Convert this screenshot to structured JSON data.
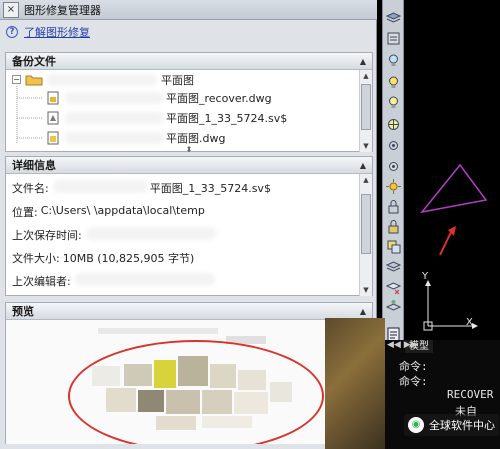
{
  "panel": {
    "title": "图形修复管理器",
    "close_label": "×",
    "learn_link": "了解图形修复"
  },
  "backup": {
    "header": "备份文件",
    "folder_label": "平面图",
    "files": [
      {
        "name": "平面图_recover.dwg"
      },
      {
        "name": "平面图_1_33_5724.sv$"
      },
      {
        "name": "平面图.dwg"
      }
    ]
  },
  "details": {
    "header": "详细信息",
    "rows": [
      {
        "label": "文件名:",
        "value": "平面图_1_33_5724.sv$"
      },
      {
        "label": "位置:",
        "value": "C:\\Users\\         \\appdata\\local\\temp"
      },
      {
        "label": "上次保存时间:",
        "value": ""
      },
      {
        "label": "文件大小:",
        "value": "10MB (10,825,905 字节)"
      },
      {
        "label": "上次编辑者:",
        "value": ""
      }
    ]
  },
  "preview": {
    "header": "预览"
  },
  "drawing": {
    "axis_y": "Y",
    "axis_x": "X",
    "model_tab": "模型"
  },
  "command": {
    "lines": [
      "命令:",
      "命令:",
      "RECOVER"
    ],
    "partial": "未自"
  },
  "watermark": {
    "text": "全球软件中心"
  },
  "colors": {
    "triangle": "#b43cc8",
    "arrow": "#e0302a",
    "ellipse": "#d8342c",
    "link": "#2440a8"
  }
}
